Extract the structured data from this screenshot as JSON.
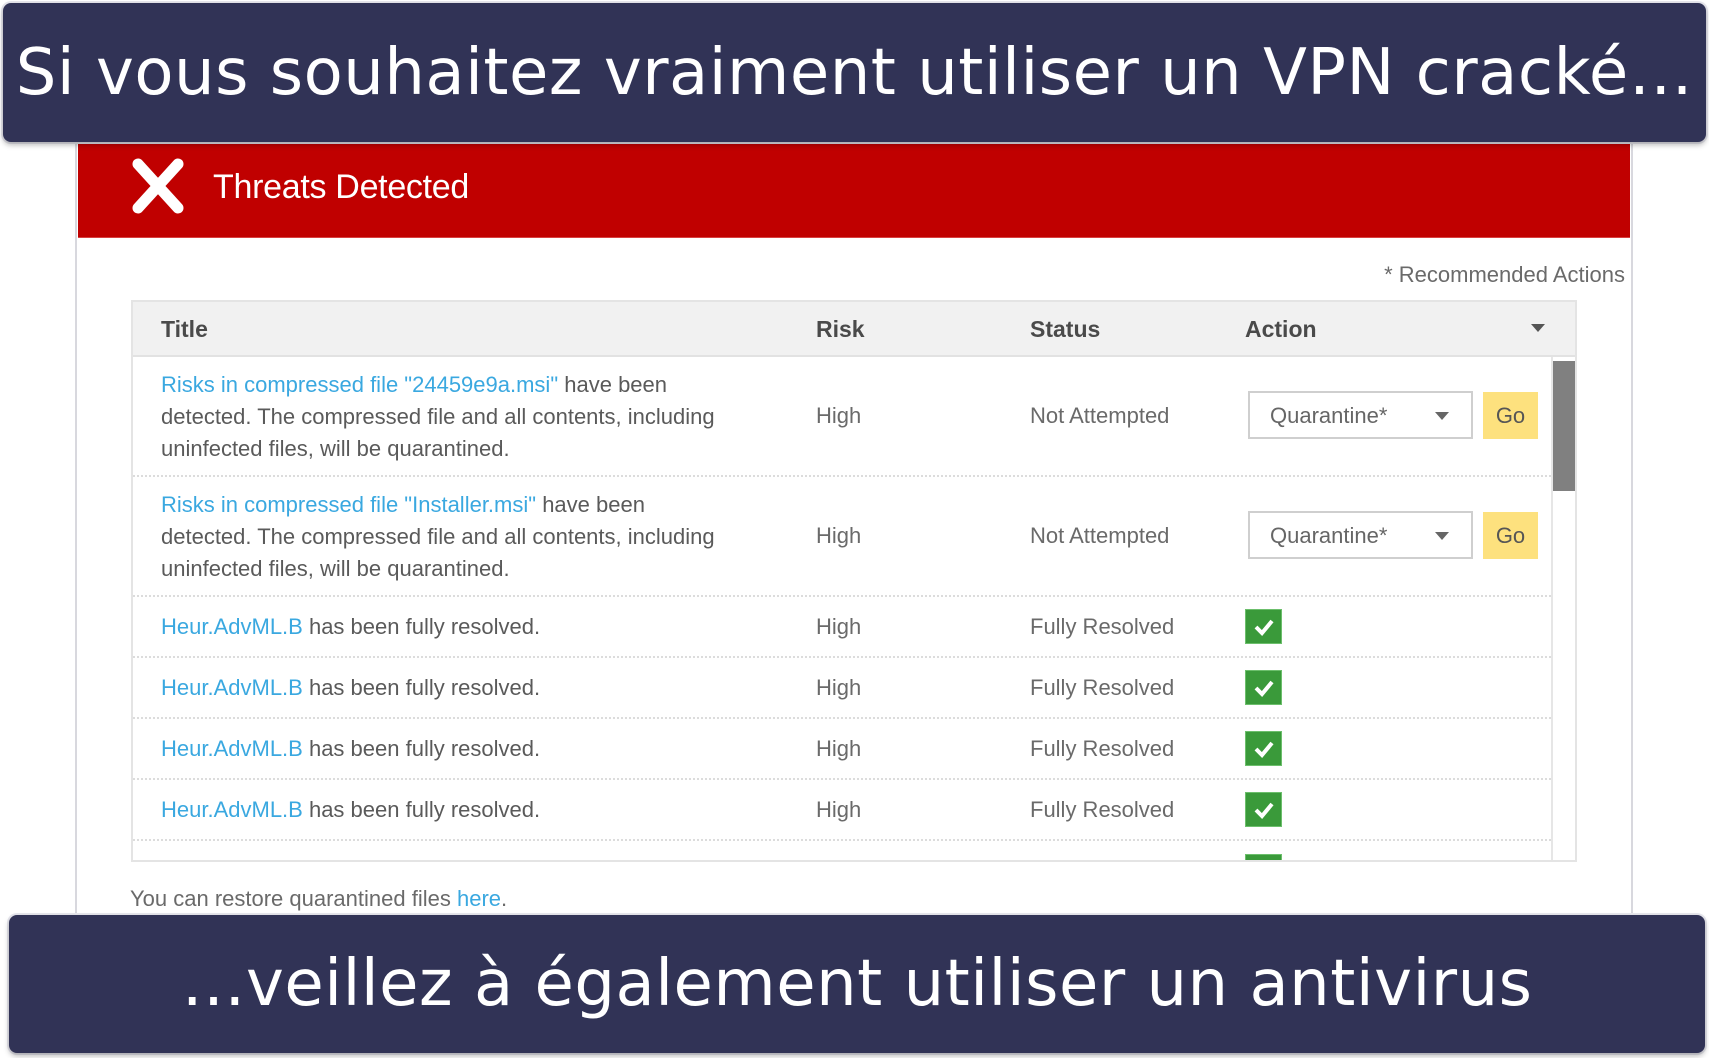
{
  "banners": {
    "top": "Si vous souhaitez vraiment utiliser un VPN cracké…",
    "bottom": "…veillez à également utiliser un antivirus"
  },
  "dialog": {
    "title": "Threats Detected",
    "icon": "x-icon",
    "recommended_note": "* Recommended Actions",
    "colors": {
      "header_red": "#c00000",
      "link_blue": "#3aa8e0",
      "go_yellow": "#fde17e",
      "check_green": "#3a9a3a",
      "banner_navy": "#313356"
    }
  },
  "table": {
    "columns": [
      "Title",
      "Risk",
      "Status",
      "Action"
    ],
    "rows": [
      {
        "link": "Risks in compressed file \"24459e9a.msi\"",
        "text_line1": " have been",
        "text_line2": "detected. The compressed file and all contents, including",
        "text_line3": "uninfected files, will be quarantined.",
        "risk": "High",
        "status": "Not Attempted",
        "action_select": "Quarantine*",
        "action_button": "Go"
      },
      {
        "link": "Risks in compressed file \"Installer.msi\"",
        "text_line1": " have been",
        "text_line2": "detected. The compressed file and all contents, including",
        "text_line3": "uninfected files, will be quarantined.",
        "risk": "High",
        "status": "Not Attempted",
        "action_select": "Quarantine*",
        "action_button": "Go"
      },
      {
        "link": "Heur.AdvML.B",
        "text_line1": " has been fully resolved.",
        "risk": "High",
        "status": "Fully Resolved",
        "action": "check"
      },
      {
        "link": "Heur.AdvML.B",
        "text_line1": " has been fully resolved.",
        "risk": "High",
        "status": "Fully Resolved",
        "action": "check"
      },
      {
        "link": "Heur.AdvML.B",
        "text_line1": " has been fully resolved.",
        "risk": "High",
        "status": "Fully Resolved",
        "action": "check"
      },
      {
        "link": "Heur.AdvML.B",
        "text_line1": " has been fully resolved.",
        "risk": "High",
        "status": "Fully Resolved",
        "action": "check"
      }
    ]
  },
  "footer": {
    "restore_text": "You can restore quarantined files ",
    "restore_link": "here",
    "restore_end": "."
  }
}
